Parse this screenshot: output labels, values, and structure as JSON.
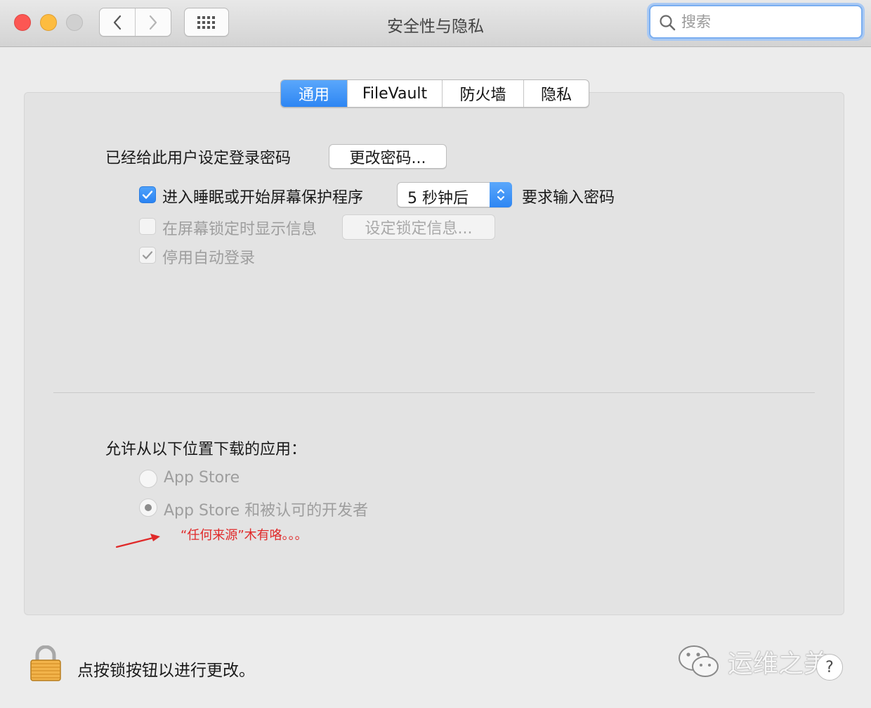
{
  "window": {
    "title": "安全性与隐私",
    "search_placeholder": "搜索"
  },
  "tabs": [
    {
      "label": "通用",
      "active": true
    },
    {
      "label": "FileVault",
      "active": false
    },
    {
      "label": "防火墙",
      "active": false
    },
    {
      "label": "隐私",
      "active": false
    }
  ],
  "general": {
    "password_label": "已经给此用户设定登录密码",
    "change_password_button": "更改密码...",
    "require_password": {
      "checked": true,
      "label": "进入睡眠或开始屏幕保护程序",
      "delay_value": "5 秒钟后",
      "suffix": "要求输入密码"
    },
    "show_message": {
      "checked": false,
      "label": "在屏幕锁定时显示信息",
      "button": "设定锁定信息..."
    },
    "disable_autologin": {
      "checked": true,
      "label": "停用自动登录"
    }
  },
  "downloads": {
    "heading": "允许从以下位置下载的应用：",
    "options": [
      {
        "label": "App Store",
        "selected": false
      },
      {
        "label": "App Store 和被认可的开发者",
        "selected": true
      }
    ],
    "annotation": "“任何来源”木有咯。。。"
  },
  "footer": {
    "lock_label": "点按锁按钮以进行更改。",
    "help_label": "?",
    "watermark": "运维之美"
  },
  "colors": {
    "accent": "#2e86f3",
    "annotation": "#e02a2a",
    "close": "#fc5753",
    "minimize": "#fdbc40"
  }
}
